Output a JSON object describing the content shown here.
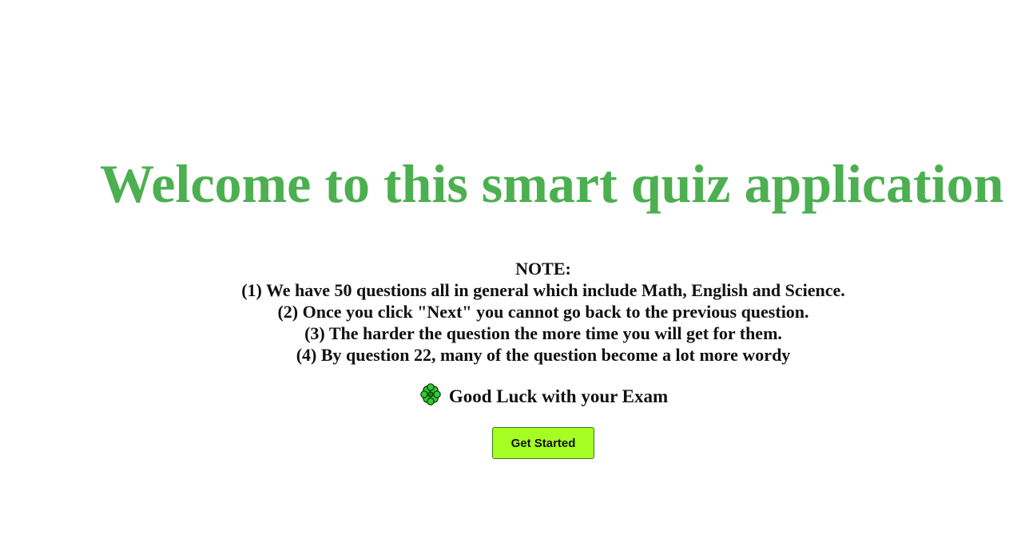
{
  "title": "Welcome to this smart quiz application",
  "notes": {
    "heading": "NOTE:",
    "items": [
      "(1) We have 50 questions all in general which include Math, English and Science.",
      "(2) Once you click \"Next\" you cannot go back to the previous question.",
      "(3) The harder the question the more time you will get for them.",
      "(4) By question 22, many of the question become a lot more wordy"
    ]
  },
  "good_luck": {
    "icon": "four-leaf-clover-icon",
    "text": "Good Luck with your Exam"
  },
  "button": {
    "label": "Get Started"
  },
  "colors": {
    "title": "#4caf50",
    "button_bg": "#a6ff22",
    "text": "#111111"
  }
}
